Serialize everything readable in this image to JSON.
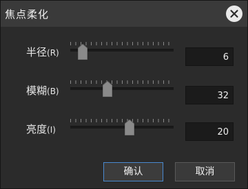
{
  "dialog": {
    "title": "焦点柔化",
    "close_icon": "close-icon"
  },
  "rows": [
    {
      "label": "半径",
      "suffix": "(R)",
      "value": "6",
      "slider_fraction": 0.08
    },
    {
      "label": "模糊",
      "suffix": "(B)",
      "value": "32",
      "slider_fraction": 0.32
    },
    {
      "label": "亮度",
      "suffix": "(I)",
      "value": "20",
      "slider_fraction": 0.53
    }
  ],
  "buttons": {
    "ok": "确认",
    "cancel": "取消"
  }
}
